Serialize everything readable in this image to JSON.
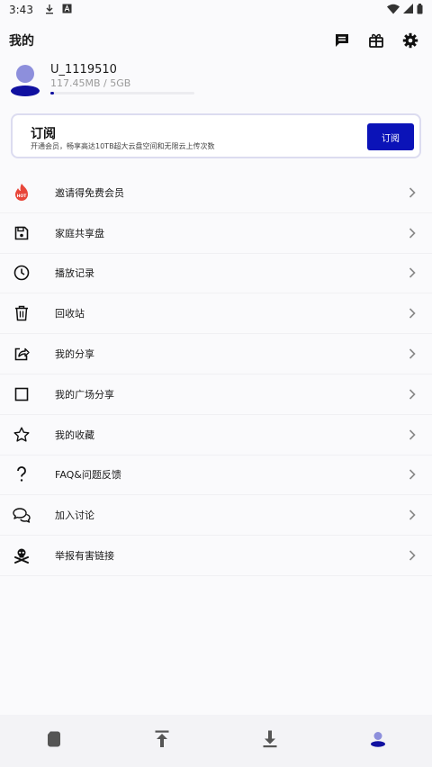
{
  "status_bar": {
    "time": "3:43",
    "left_icons": [
      "download-notification-icon",
      "a-notification-icon"
    ],
    "right_icons": [
      "wifi-icon",
      "signal-icon",
      "battery-icon"
    ]
  },
  "header": {
    "title": "我的",
    "actions": [
      "message-icon",
      "gift-icon",
      "settings-icon"
    ]
  },
  "profile": {
    "username": "U_1119510",
    "storage": "117.45MB / 5GB",
    "storage_used_fraction": 0.023
  },
  "subscription": {
    "title": "订阅",
    "description": "开通会员，畅享高达10TB超大云盘空间和无限云上传次数",
    "button_label": "订阅"
  },
  "menu": [
    {
      "label": "邀请得免费会员",
      "icon": "hot-flame-icon"
    },
    {
      "label": "家庭共享盘",
      "icon": "floppy-disk-icon"
    },
    {
      "label": "播放记录",
      "icon": "clock-icon"
    },
    {
      "label": "回收站",
      "icon": "trash-icon"
    },
    {
      "label": "我的分享",
      "icon": "share-icon"
    },
    {
      "label": "我的广场分享",
      "icon": "square-icon"
    },
    {
      "label": "我的收藏",
      "icon": "star-icon"
    },
    {
      "label": "FAQ&问题反馈",
      "icon": "question-icon"
    },
    {
      "label": "加入讨论",
      "icon": "chat-icon"
    },
    {
      "label": "举报有害链接",
      "icon": "skull-crossbones-icon"
    }
  ],
  "bottom_nav": [
    {
      "name": "files",
      "icon": "file-icon",
      "active": false
    },
    {
      "name": "upload",
      "icon": "upload-icon",
      "active": false
    },
    {
      "name": "download",
      "icon": "download-icon",
      "active": false
    },
    {
      "name": "profile",
      "icon": "person-icon",
      "active": true
    }
  ],
  "colors": {
    "accent": "#0b13b8",
    "avatar_head": "#8d8fdc",
    "avatar_body": "#1010a0",
    "hot": "#e8463a",
    "icon_inactive": "#555555"
  }
}
